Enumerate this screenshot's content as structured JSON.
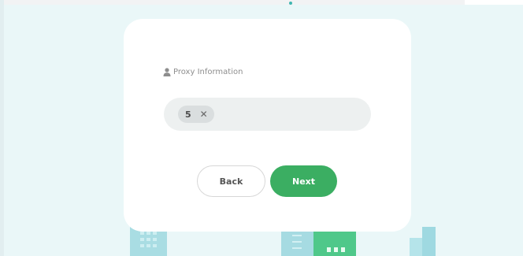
{
  "form": {
    "section_label": "Proxy Information",
    "section_icon": "user-icon",
    "tags": [
      {
        "value": "5",
        "remove_icon": "close-icon"
      }
    ]
  },
  "actions": {
    "back_label": "Back",
    "next_label": "Next"
  },
  "colors": {
    "accent": "#3bae62",
    "background": "#eaf7f8",
    "card": "#ffffff",
    "field": "#edf0f0"
  }
}
